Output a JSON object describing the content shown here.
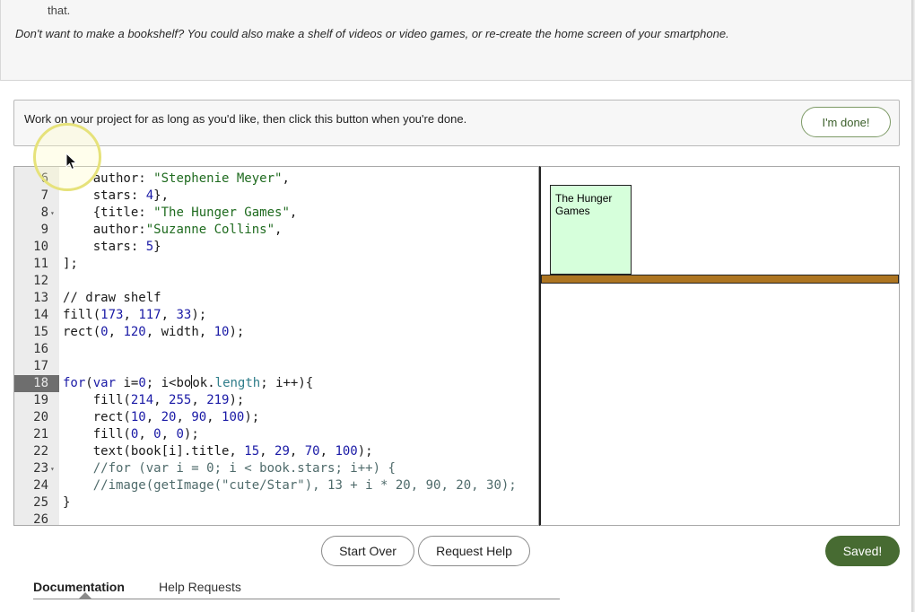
{
  "instructions": {
    "fragment": "that.",
    "italic_note": "Don't want to make a bookshelf? You could also make a shelf of videos or video games, or re-create the home screen of your smartphone."
  },
  "prompt": {
    "text": "Work on your project for as long as you'd like, then click this button when you're done.",
    "done_label": "I'm done!"
  },
  "editor": {
    "active_line": "18",
    "lines": [
      {
        "n": "6",
        "fold": ""
      },
      {
        "n": "7",
        "fold": ""
      },
      {
        "n": "8",
        "fold": "▾"
      },
      {
        "n": "9",
        "fold": ""
      },
      {
        "n": "10",
        "fold": ""
      },
      {
        "n": "11",
        "fold": ""
      },
      {
        "n": "12",
        "fold": ""
      },
      {
        "n": "13",
        "fold": ""
      },
      {
        "n": "14",
        "fold": ""
      },
      {
        "n": "15",
        "fold": ""
      },
      {
        "n": "16",
        "fold": ""
      },
      {
        "n": "17",
        "fold": ""
      },
      {
        "n": "18",
        "fold": ""
      },
      {
        "n": "19",
        "fold": ""
      },
      {
        "n": "20",
        "fold": ""
      },
      {
        "n": "21",
        "fold": ""
      },
      {
        "n": "22",
        "fold": ""
      },
      {
        "n": "23",
        "fold": "▾"
      },
      {
        "n": "24",
        "fold": ""
      },
      {
        "n": "25",
        "fold": ""
      },
      {
        "n": "26",
        "fold": ""
      }
    ],
    "code": {
      "l6_author_key": "author: ",
      "l6_author_val": "\"Stephenie Meyer\"",
      "l7_stars": "stars: ",
      "l7_num": "4",
      "l8_open": "{title: ",
      "l8_val": "\"The Hunger Games\"",
      "l9_key": "author:",
      "l9_val": "\"Suzanne Collins\"",
      "l10_key": "stars: ",
      "l10_num": "5",
      "l11": "];",
      "l13": "// draw shelf",
      "l14_fn": "fill(",
      "l14_a": "173",
      "l14_b": "117",
      "l14_c": "33",
      "l15_fn": "rect(",
      "l15_a": "0",
      "l15_b": "120",
      "l15_w": "width",
      "l15_d": "10",
      "l18_for": "for",
      "l18_var": "var",
      "l18_i": " i=",
      "l18_zero": "0",
      "l18_mid1": "; i<bo",
      "l18_mid2": "ok.",
      "l18_len": "length",
      "l18_end": "; i++){",
      "l19_fn": "fill(",
      "l19_a": "214",
      "l19_b": "255",
      "l19_c": "219",
      "l20_fn": "rect(",
      "l20_a": "10",
      "l20_b": "20",
      "l20_c": "90",
      "l20_d": "100",
      "l21_fn": "fill(",
      "l21_a": "0",
      "l21_b": "0",
      "l21_c": "0",
      "l22_fn": "text(book[i].title, ",
      "l22_a": "15",
      "l22_b": "29",
      "l22_c": "70",
      "l22_d": "100",
      "l23": "//for (var i = 0; i < book.stars; i++) {",
      "l24": "//image(getImage(\"cute/Star\"), 13 + i * 20, 90, 20, 30);",
      "l25": "}"
    }
  },
  "output": {
    "book_title": "The Hunger Games",
    "book_fill": "#d6ffdb",
    "shelf_fill": "#ad7521"
  },
  "buttons": {
    "start_over": "Start Over",
    "request_help": "Request Help",
    "saved": "Saved!"
  },
  "tabs": {
    "documentation": "Documentation",
    "help_requests": "Help Requests"
  }
}
